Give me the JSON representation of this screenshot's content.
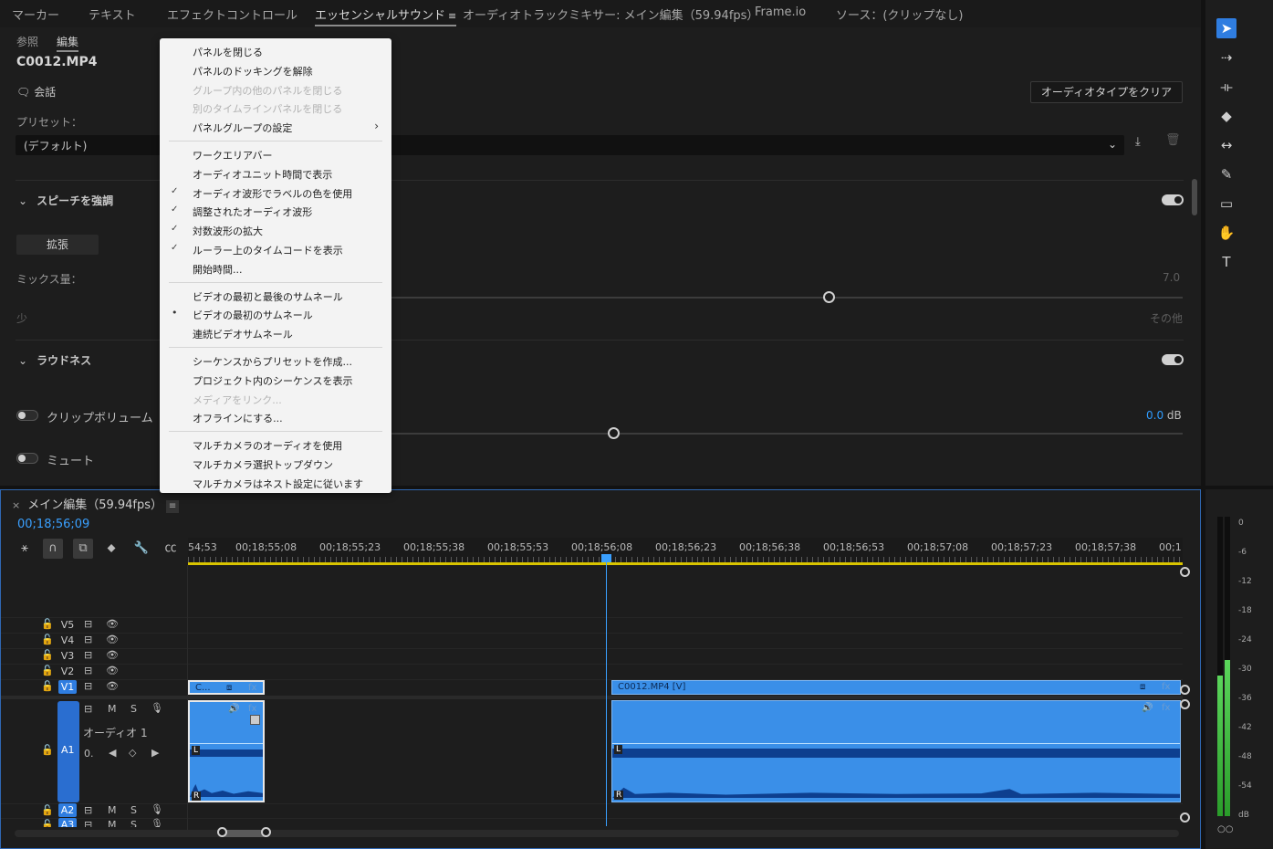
{
  "top_tabs": [
    {
      "label": "マーカー"
    },
    {
      "label": "テキスト"
    },
    {
      "label": "エフェクトコントロール"
    },
    {
      "label": "エッセンシャルサウンド",
      "active": true
    },
    {
      "label": "オーディオトラックミキサー: メイン編集（59.94fps）"
    },
    {
      "label": "Frame.io"
    },
    {
      "label": "ソース：(クリップなし)"
    }
  ],
  "tab_menu_glyph": "≡",
  "sub_tabs": {
    "browse": "参照",
    "edit": "編集"
  },
  "clip_name": "C0012.MP4",
  "audio_type_label": "会話",
  "clear_audio_type_button": "オーディオタイプをクリア",
  "preset_label": "プリセット：",
  "preset_value": "(デフォルト)",
  "speech": {
    "title": "スピーチを強調",
    "expand_button": "拡張",
    "mix_label": "ミックス量：",
    "mix_value": "7.0",
    "min_label": "少",
    "max_label": "その他"
  },
  "loudness": {
    "title": "ラウドネス",
    "clip_volume_label": "クリップボリューム",
    "clip_volume_value": "0.0",
    "clip_volume_unit": "dB",
    "mute_label": "ミュート"
  },
  "context_menu": {
    "items": [
      {
        "label": "パネルを閉じる"
      },
      {
        "label": "パネルのドッキングを解除"
      },
      {
        "label": "グループ内の他のパネルを閉じる",
        "disabled": true
      },
      {
        "label": "別のタイムラインパネルを閉じる",
        "disabled": true
      },
      {
        "label": "パネルグループの設定",
        "submenu": true
      },
      {
        "separator": true
      },
      {
        "label": "ワークエリアバー"
      },
      {
        "label": "オーディオユニット時間で表示"
      },
      {
        "label": "オーディオ波形でラベルの色を使用",
        "checked": true
      },
      {
        "label": "調整されたオーディオ波形",
        "checked": true
      },
      {
        "label": "対数波形の拡大",
        "checked": true
      },
      {
        "label": "ルーラー上のタイムコードを表示",
        "checked": true
      },
      {
        "label": "開始時間..."
      },
      {
        "separator": true
      },
      {
        "label": "ビデオの最初と最後のサムネール"
      },
      {
        "label": "ビデオの最初のサムネール",
        "radio": true
      },
      {
        "label": "連続ビデオサムネール"
      },
      {
        "separator": true
      },
      {
        "label": "シーケンスからプリセットを作成..."
      },
      {
        "label": "プロジェクト内のシーケンスを表示"
      },
      {
        "label": "メディアをリンク...",
        "disabled": true
      },
      {
        "label": "オフラインにする..."
      },
      {
        "separator": true
      },
      {
        "label": "マルチカメラのオーディオを使用"
      },
      {
        "label": "マルチカメラ選択トップダウン"
      },
      {
        "label": "マルチカメラはネスト設定に従います"
      }
    ]
  },
  "timeline": {
    "tab_title": "メイン編集（59.94fps）",
    "close_glyph": "×",
    "timecode": "00;18;56;09",
    "ruler_labels": [
      "54;53",
      "00;18;55;08",
      "00;18;55;23",
      "00;18;55;38",
      "00;18;55;53",
      "00;18;56;08",
      "00;18;56;23",
      "00;18;56;38",
      "00;18;56;53",
      "00;18;57;08",
      "00;18;57;23",
      "00;18;57;38",
      "00;1"
    ],
    "video_tracks": [
      "V5",
      "V4",
      "V3",
      "V2",
      "V1"
    ],
    "audio_tracks": [
      "A1",
      "A2",
      "A3"
    ],
    "track_buttons": {
      "mute": "M",
      "solo": "S"
    },
    "audio1_name": "オーディオ 1",
    "audio1_level": "0.",
    "clips": {
      "left_video_label": "C...",
      "right_video_label": "C0012.MP4 [V]",
      "fx_label": "fx",
      "channel_left": "L",
      "channel_right": "R"
    }
  },
  "meter": {
    "scale": [
      "0",
      "-6",
      "-12",
      "-18",
      "-24",
      "-30",
      "-36",
      "-42",
      "-48",
      "-54",
      "dB"
    ],
    "left_level_fraction": 0.47,
    "right_level_fraction": 0.52,
    "solo_buttons": "○○"
  },
  "colors": {
    "accent": "#2f7de0",
    "clip": "#3a8fe8",
    "waveform": "#0d3f8f",
    "timecode": "#3aa0ff",
    "workarea": "#d9c400"
  }
}
